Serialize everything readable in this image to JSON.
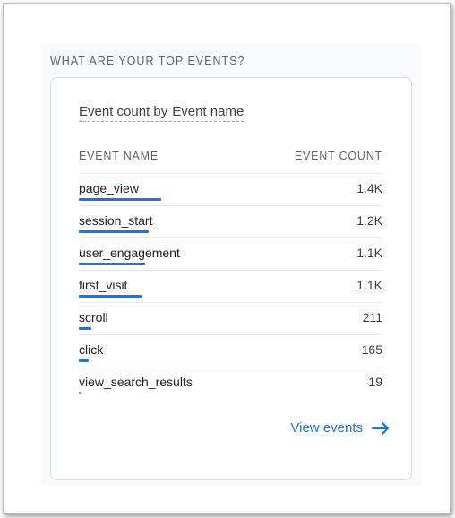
{
  "section": {
    "title": "WHAT ARE YOUR TOP EVENTS?"
  },
  "card": {
    "title_part1": "Event count by",
    "title_part2": "Event name",
    "col_name": "EVENT NAME",
    "col_count": "EVENT COUNT"
  },
  "events": [
    {
      "name": "page_view",
      "count": "1.4K",
      "share": 1.0
    },
    {
      "name": "session_start",
      "count": "1.2K",
      "share": 0.85
    },
    {
      "name": "user_engagement",
      "count": "1.1K",
      "share": 0.8
    },
    {
      "name": "first_visit",
      "count": "1.1K",
      "share": 0.76
    },
    {
      "name": "scroll",
      "count": "211",
      "share": 0.15
    },
    {
      "name": "click",
      "count": "165",
      "share": 0.12
    },
    {
      "name": "view_search_results",
      "count": "19",
      "share": 0.014
    }
  ],
  "footer": {
    "link_label": "View events"
  },
  "colors": {
    "accent": "#1a73e8",
    "text": "#202124",
    "muted": "#5f6368"
  },
  "icons": {
    "view_link": "arrow-right-icon"
  }
}
